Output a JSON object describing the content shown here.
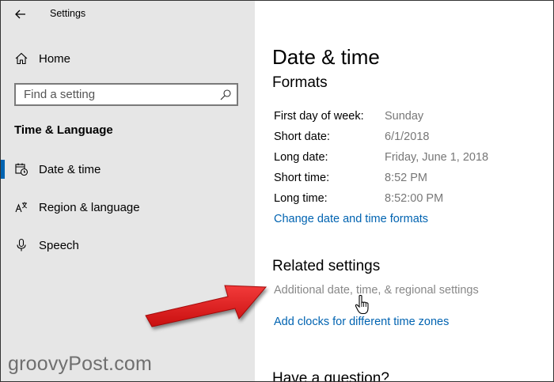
{
  "window": {
    "title": "Settings"
  },
  "sidebar": {
    "home_label": "Home",
    "search": {
      "placeholder": "Find a setting"
    },
    "section_title": "Time & Language",
    "items": [
      {
        "label": "Date & time",
        "icon": "date-time-icon",
        "active": true
      },
      {
        "label": "Region & language",
        "icon": "region-language-icon",
        "active": false
      },
      {
        "label": "Speech",
        "icon": "microphone-icon",
        "active": false
      }
    ],
    "accent_color": "#0063b1"
  },
  "main": {
    "page_title": "Date & time",
    "formats": {
      "title": "Formats",
      "rows": [
        {
          "label": "First day of week:",
          "value": "Sunday"
        },
        {
          "label": "Short date:",
          "value": "6/1/2018"
        },
        {
          "label": "Long date:",
          "value": "Friday, June 1, 2018"
        },
        {
          "label": "Short time:",
          "value": "8:52 PM"
        },
        {
          "label": "Long time:",
          "value": "8:52:00 PM"
        }
      ],
      "change_link": "Change date and time formats"
    },
    "related": {
      "title": "Related settings",
      "additional_link": "Additional date, time, & regional settings",
      "clocks_link": "Add clocks for different time zones"
    },
    "question_title": "Have a question?"
  },
  "watermark": "groovyPost.com",
  "annotation": {
    "arrow_color": "#e21b1b"
  }
}
